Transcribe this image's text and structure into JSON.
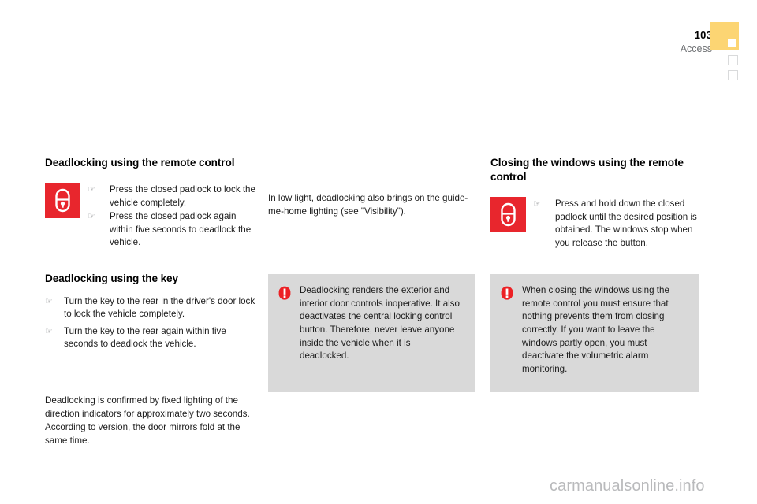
{
  "header": {
    "page_number": "103",
    "section_name": "Access",
    "active_tab_color": "#fcd573",
    "tab_count": 3
  },
  "colors": {
    "icon_red": "#e8262d",
    "warning_red": "#ec2024",
    "panel_gray": "#d9d9d9",
    "body_text": "#1b1b1b",
    "muted_text": "#6d6f72"
  },
  "icons": {
    "padlock": "closed-padlock-icon",
    "warning": "warning-exclamation-icon",
    "bullet": "pointing-hand-icon",
    "bullet_glyph": "☞"
  },
  "left_column": {
    "section1": {
      "heading": "Deadlocking using the remote control",
      "icon": "closed-padlock-icon",
      "bullets": [
        "Press the closed padlock to lock the vehicle completely.",
        "Press the closed padlock again within five seconds to deadlock the vehicle."
      ]
    },
    "section2": {
      "heading": "Deadlocking using the key",
      "bullets": [
        "Turn the key to the rear in the driver's door lock to lock the vehicle completely.",
        "Turn the key to the rear again within five seconds to deadlock the vehicle."
      ]
    },
    "closing_paragraph": "Deadlocking is confirmed by fixed lighting of the direction indicators for approximately two seconds. According to version, the door mirrors fold at the same time."
  },
  "middle_column": {
    "paragraph": "In low light, deadlocking also brings on the guide-me-home lighting (see \"Visibility\").",
    "warning": {
      "icon": "warning-exclamation-icon",
      "text": "Deadlocking renders the exterior and interior door controls inoperative. It also deactivates the central locking control button. Therefore, never leave anyone inside the vehicle when it is deadlocked."
    }
  },
  "right_column": {
    "section1": {
      "heading": "Closing the windows using the remote control",
      "icon": "closed-padlock-icon",
      "bullets": [
        "Press and hold down the closed padlock until the desired position is obtained. The windows stop when you release the button."
      ]
    },
    "warning": {
      "icon": "warning-exclamation-icon",
      "text": "When closing the windows using the remote control you must ensure that nothing prevents them from closing correctly. If you want to leave the windows partly open, you must deactivate the volumetric alarm monitoring."
    }
  },
  "watermark": {
    "text": "carmanualsonline.info"
  }
}
